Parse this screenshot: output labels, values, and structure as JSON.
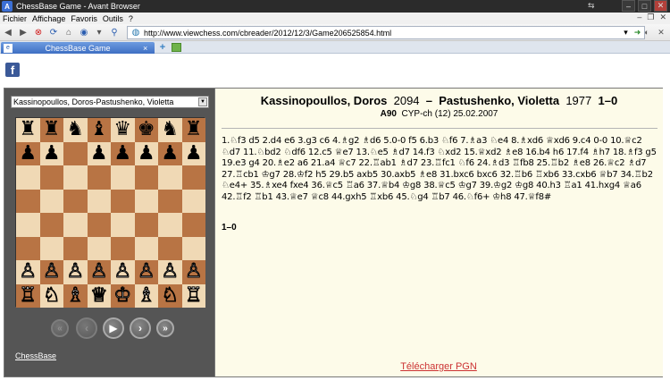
{
  "window": {
    "title": "ChessBase Game - Avant Browser",
    "app_icon": "A"
  },
  "menu": [
    "Fichier",
    "Affichage",
    "Favoris",
    "Outils",
    "?"
  ],
  "address": {
    "url": "http://www.viewchess.com/cbreader/2012/12/3/Game206525854.html"
  },
  "tab": {
    "label": "ChessBase Game",
    "close": "×"
  },
  "facebook": {
    "glyph": "f"
  },
  "game_select": {
    "selected": "Kassinopoullos, Doros-Pastushenko, Violetta"
  },
  "board": {
    "rows": [
      [
        "♜",
        "♜",
        "♞",
        "♝",
        "♛",
        "♚",
        "♞",
        "♜"
      ],
      [
        "♟",
        "♟",
        "",
        "♟",
        "♟",
        "♟",
        "♟",
        "♟"
      ],
      [
        "",
        "",
        "",
        "",
        "",
        "",
        "",
        ""
      ],
      [
        "",
        "",
        "",
        "",
        "",
        "",
        "",
        ""
      ],
      [
        "",
        "",
        "",
        "",
        "",
        "",
        "",
        ""
      ],
      [
        "",
        "",
        "",
        "",
        "",
        "",
        "",
        ""
      ],
      [
        "♙",
        "♙",
        "♙",
        "♙",
        "♙",
        "♙",
        "♙",
        "♙"
      ],
      [
        "♖",
        "♘",
        "♗",
        "♕",
        "♔",
        "♗",
        "♘",
        "♖"
      ]
    ]
  },
  "nav": {
    "first": "«",
    "prev": "‹",
    "play": "▶",
    "next": "›",
    "last": "»"
  },
  "chessbase_link": "ChessBase",
  "game": {
    "white": "Kassinopoullos, Doros",
    "white_elo": "2094",
    "dash": "–",
    "black": "Pastushenko, Violetta",
    "black_elo": "1977",
    "result": "1–0",
    "eco": "A90",
    "event": "CYP-ch (12) 25.02.2007",
    "moves": "1.♘f3 d5 2.d4 e6 3.g3 c6 4.♗g2 ♗d6 5.0-0 f5 6.b3 ♘f6 7.♗a3 ♘e4 8.♗xd6 ♕xd6 9.c4 0-0 10.♕c2 ♘d7 11.♘bd2 ♘df6 12.c5 ♕e7 13.♘e5 ♗d7 14.f3 ♘xd2 15.♕xd2 ♗e8 16.b4 h6 17.f4 ♗h7 18.♗f3 g5 19.e3 g4 20.♗e2 a6 21.a4 ♕c7 22.♖ab1 ♗d7 23.♖fc1 ♘f6 24.♗d3 ♖fb8 25.♖b2 ♗e8 26.♕c2 ♗d7 27.♖cb1 ♔g7 28.♔f2 h5 29.b5 axb5 30.axb5 ♗e8 31.bxc6 bxc6 32.♖b6 ♖xb6 33.cxb6 ♕b7 34.♖b2 ♘e4+ 35.♗xe4 fxe4 36.♕c5 ♖a6 37.♕b4 ♔g8 38.♕c5 ♔g7 39.♔g2 ♔g8 40.h3 ♖a1 41.hxg4 ♕a6 42.♖f2 ♖b1 43.♕e7 ♕c8 44.gxh5 ♖xb6 45.♘g4 ♖b7 46.♘f6+ ♔h8 47.♕f8#",
    "final": "1–0"
  },
  "download_link": "Télécharger PGN"
}
